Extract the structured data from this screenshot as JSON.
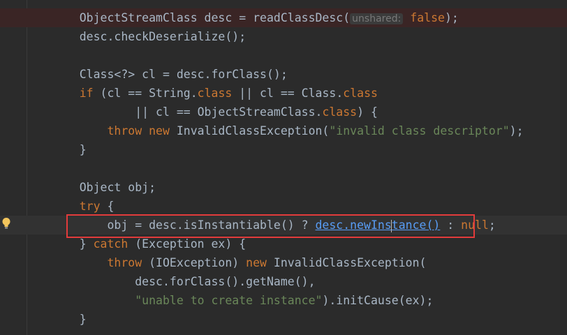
{
  "lines": [
    {
      "indent": "    ",
      "tokens": [
        {
          "t": "ObjectStreamClass desc = readClassDesc(",
          "c": ""
        },
        {
          "t": "unshared:",
          "c": "hint"
        },
        {
          "t": " false",
          "c": "kw"
        },
        {
          "t": ");",
          "c": ""
        }
      ]
    },
    {
      "indent": "    ",
      "tokens": [
        {
          "t": "desc.checkDeserialize();",
          "c": ""
        }
      ]
    },
    {
      "indent": "",
      "tokens": []
    },
    {
      "indent": "    ",
      "tokens": [
        {
          "t": "Class<?> cl = desc.forClass();",
          "c": ""
        }
      ]
    },
    {
      "indent": "    ",
      "tokens": [
        {
          "t": "if",
          "c": "kw"
        },
        {
          "t": " (cl == String.",
          "c": ""
        },
        {
          "t": "class",
          "c": "kw"
        },
        {
          "t": " || cl == Class.",
          "c": ""
        },
        {
          "t": "class",
          "c": "kw"
        }
      ]
    },
    {
      "indent": "            ",
      "tokens": [
        {
          "t": "|| cl == ObjectStreamClass.",
          "c": ""
        },
        {
          "t": "class",
          "c": "kw"
        },
        {
          "t": ") {",
          "c": ""
        }
      ]
    },
    {
      "indent": "        ",
      "tokens": [
        {
          "t": "throw new",
          "c": "kw"
        },
        {
          "t": " InvalidClassException(",
          "c": ""
        },
        {
          "t": "\"invalid class descriptor\"",
          "c": "str"
        },
        {
          "t": ");",
          "c": ""
        }
      ]
    },
    {
      "indent": "    ",
      "tokens": [
        {
          "t": "}",
          "c": ""
        }
      ]
    },
    {
      "indent": "",
      "tokens": []
    },
    {
      "indent": "    ",
      "tokens": [
        {
          "t": "Object obj;",
          "c": ""
        }
      ]
    },
    {
      "indent": "    ",
      "tokens": [
        {
          "t": "try",
          "c": "kw"
        },
        {
          "t": " {",
          "c": ""
        }
      ]
    },
    {
      "indent": "        ",
      "tokens": [
        {
          "t": "obj = desc.isInstantiable() ? ",
          "c": ""
        },
        {
          "t": "desc.",
          "c": "lnk"
        },
        {
          "t": "newIns",
          "c": "lnk"
        },
        {
          "t": "|",
          "c": "cursor"
        },
        {
          "t": "tance()",
          "c": "lnk"
        },
        {
          "t": " : ",
          "c": ""
        },
        {
          "t": "null",
          "c": "kw"
        },
        {
          "t": ";",
          "c": ""
        }
      ]
    },
    {
      "indent": "    ",
      "tokens": [
        {
          "t": "} ",
          "c": ""
        },
        {
          "t": "catch",
          "c": "kw"
        },
        {
          "t": " (Exception ex) {",
          "c": ""
        }
      ]
    },
    {
      "indent": "        ",
      "tokens": [
        {
          "t": "throw",
          "c": "kw"
        },
        {
          "t": " (IOException) ",
          "c": ""
        },
        {
          "t": "new",
          "c": "kw"
        },
        {
          "t": " InvalidClassException(",
          "c": ""
        }
      ]
    },
    {
      "indent": "            ",
      "tokens": [
        {
          "t": "desc.forClass().getName(),",
          "c": ""
        }
      ]
    },
    {
      "indent": "            ",
      "tokens": [
        {
          "t": "\"unable to create instance\"",
          "c": "str"
        },
        {
          "t": ").initCause(ex);",
          "c": ""
        }
      ]
    },
    {
      "indent": "    ",
      "tokens": [
        {
          "t": "}",
          "c": ""
        }
      ]
    }
  ],
  "icons": {
    "gutter": "lightbulb-icon"
  },
  "colors": {
    "background": "#2b2b2b",
    "keyword": "#cc7832",
    "string": "#6a8759",
    "link": "#589df6",
    "highlight_box": "#e23b3b"
  }
}
